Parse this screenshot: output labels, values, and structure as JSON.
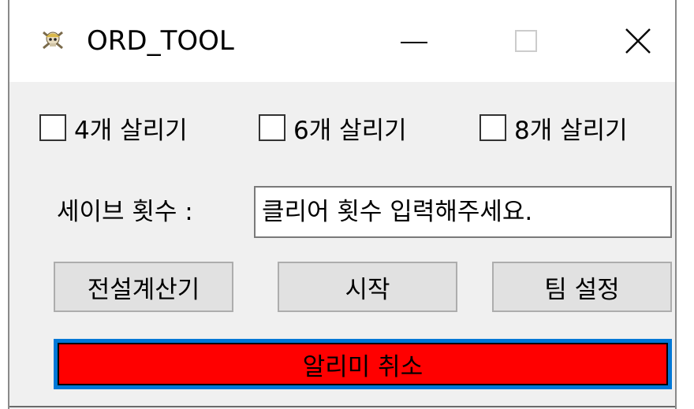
{
  "window": {
    "title": "ORD_TOOL",
    "icon": "skull-crossbones-icon",
    "controls": [
      "minimize-icon",
      "maximize-icon",
      "close-icon"
    ],
    "close_glyph": "✕"
  },
  "options": [
    {
      "label": "4개 살리기",
      "checked": false
    },
    {
      "label": "6개 살리기",
      "checked": false
    },
    {
      "label": "8개 살리기",
      "checked": false
    }
  ],
  "save": {
    "label": "세이브 횟수 :",
    "value": "",
    "placeholder": "클리어 횟수 입력해주세요."
  },
  "buttons": {
    "calc": "전설계산기",
    "start": "시작",
    "team": "팀 설정"
  },
  "alarm": {
    "label": "알리미 취소"
  },
  "colors": {
    "window_bg": "#f0f0f0",
    "titlebar_bg": "#ffffff",
    "button_bg": "#e1e1e1",
    "alarm_bg": "#ff0000",
    "focus_border": "#0078d7"
  }
}
